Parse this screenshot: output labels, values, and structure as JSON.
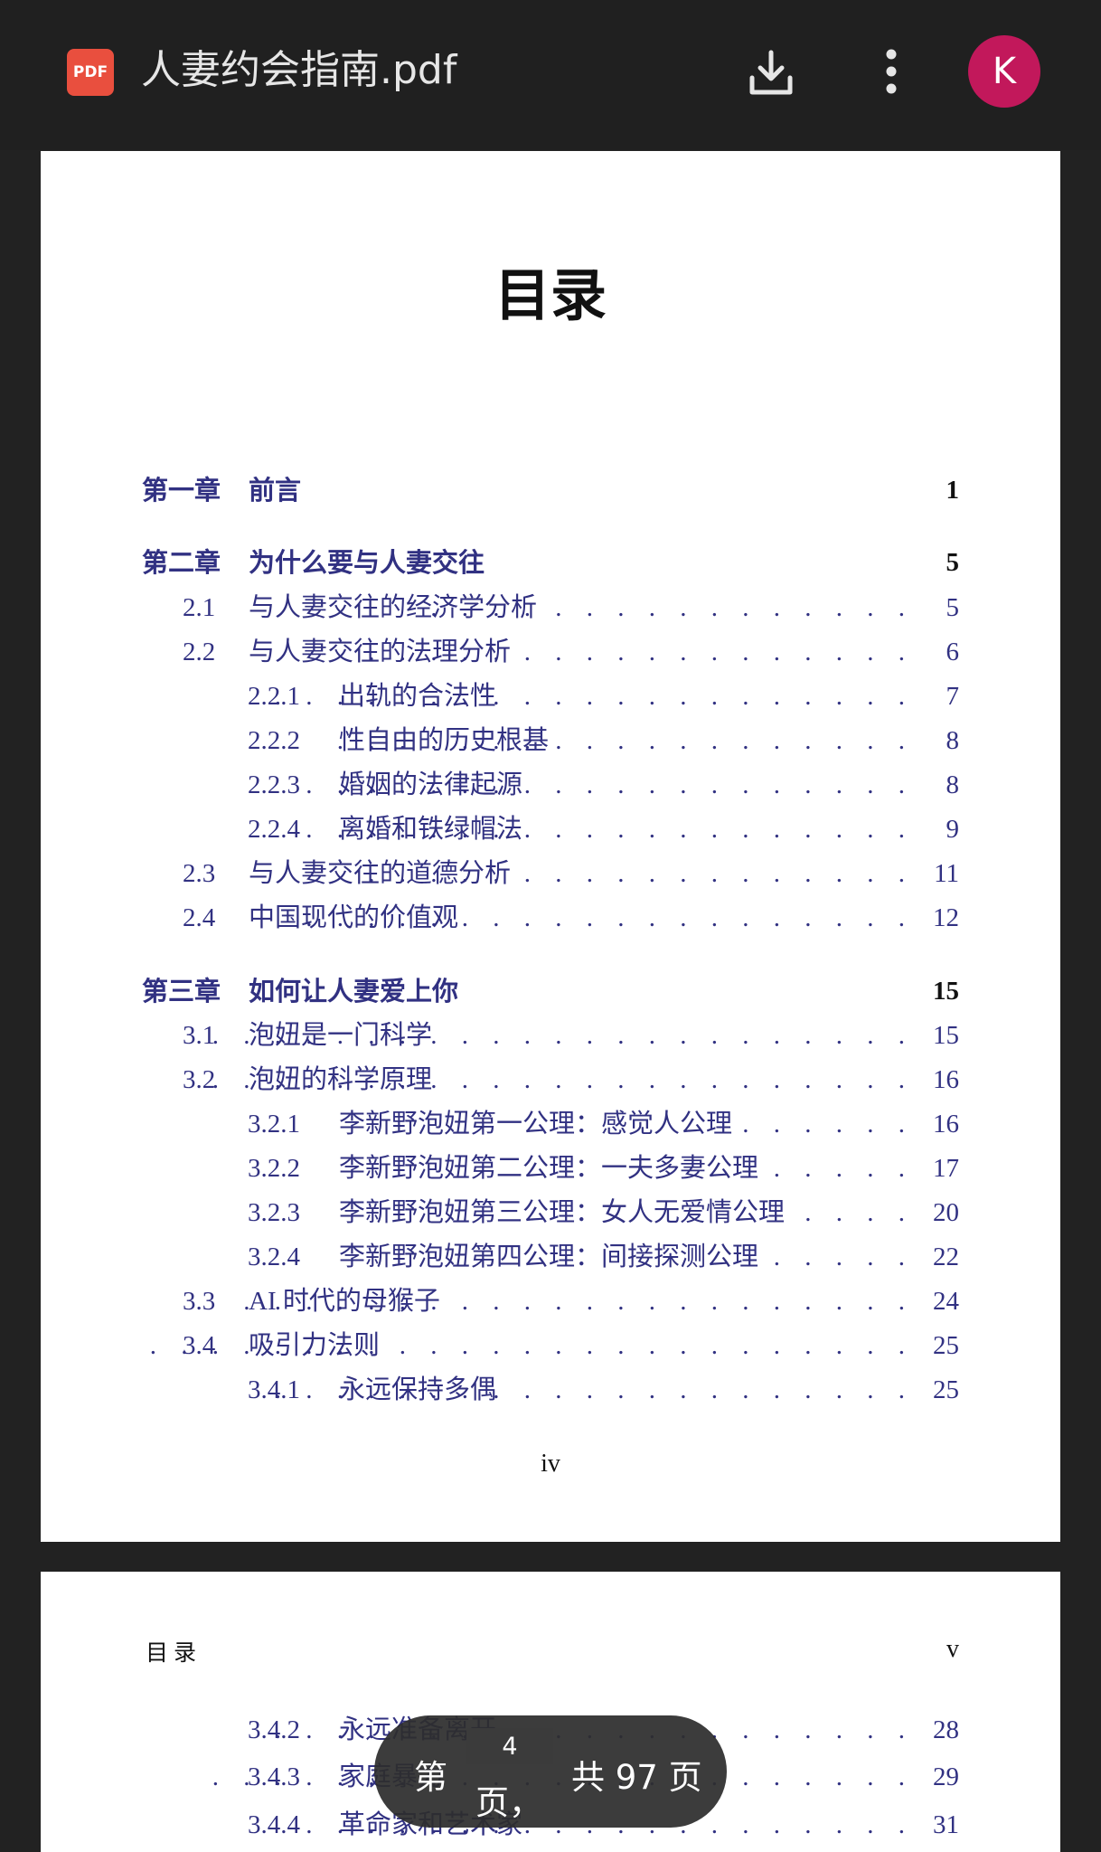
{
  "app_bar": {
    "pdf_badge": "PDF",
    "file_name": "人妻约会指南.pdf",
    "download_icon": "download-icon",
    "more_icon": "more-vert-icon",
    "avatar_letter": "K",
    "avatar_color": "#c2185b"
  },
  "colors": {
    "toc_link": "#313182",
    "background": "#222222",
    "pdf_badge": "#e94f3e"
  },
  "page1": {
    "title": "目录",
    "entries": [
      {
        "level": "chapter",
        "num": "第一章",
        "text": "前言",
        "page": "1",
        "dots": ""
      },
      {
        "level": "chapter",
        "num": "第二章",
        "text": "为什么要与人妻交往",
        "page": "5",
        "dots": ""
      },
      {
        "level": "section",
        "num": "2.1",
        "text": "与人妻交往的经济学分析",
        "page": "5",
        "dots": ". . . . . . . . . . . . . . . ."
      },
      {
        "level": "section",
        "num": "2.2",
        "text": "与人妻交往的法理分析",
        "page": "6",
        "dots": ". . . . . . . . . . . . . . . . . ."
      },
      {
        "level": "subsection",
        "num": "2.2.1",
        "text": "出轨的合法性",
        "page": "7",
        "dots": ". . . . . . . . . . . . . . . . . . . . ."
      },
      {
        "level": "subsection",
        "num": "2.2.2",
        "text": "性自由的历史根基",
        "page": "8",
        "dots": ". . . . . . . . . . . . . . . . . . ."
      },
      {
        "level": "subsection",
        "num": "2.2.3",
        "text": "婚姻的法律起源",
        "page": "8",
        "dots": ". . . . . . . . . . . . . . . . . . . ."
      },
      {
        "level": "subsection",
        "num": "2.2.4",
        "text": "离婚和铁绿帽法",
        "page": "9",
        "dots": ". . . . . . . . . . . . . . . . . . . ."
      },
      {
        "level": "section",
        "num": "2.3",
        "text": "与人妻交往的道德分析",
        "page": "11",
        "dots": ". . . . . . . . . . . . . . . . . ."
      },
      {
        "level": "section",
        "num": "2.4",
        "text": "中国现代的价值观",
        "page": "12",
        "dots": ". . . . . . . . . . . . . . . . . . . ."
      },
      {
        "level": "chapter",
        "num": "第三章",
        "text": "如何让人妻爱上你",
        "page": "15",
        "dots": ""
      },
      {
        "level": "section",
        "num": "3.1",
        "text": "泡妞是一门科学",
        "page": "15",
        "dots": ". . . . . . . . . . . . . . . . . . . . . . ."
      },
      {
        "level": "section",
        "num": "3.2",
        "text": "泡妞的科学原理",
        "page": "16",
        "dots": ". . . . . . . . . . . . . . . . . . . . . . ."
      },
      {
        "level": "subsection",
        "num": "3.2.1",
        "text": "李新野泡妞第一公理：感觉人公理",
        "page": "16",
        "dots": ". . . . . ."
      },
      {
        "level": "subsection",
        "num": "3.2.2",
        "text": "李新野泡妞第二公理：一夫多妻公理",
        "page": "17",
        "dots": ". . . . ."
      },
      {
        "level": "subsection",
        "num": "3.2.3",
        "text": "李新野泡妞第三公理：女人无爱情公理",
        "page": "20",
        "dots": ". . . ."
      },
      {
        "level": "subsection",
        "num": "3.2.4",
        "text": "李新野泡妞第四公理：间接探测公理",
        "page": "22",
        "dots": ". . . . ."
      },
      {
        "level": "section",
        "num": "3.3",
        "text": "AI 时代的母猴子",
        "page": "24",
        "dots": ". . . . . . . . . . . . . . . . . . . . . ."
      },
      {
        "level": "section",
        "num": "3.4",
        "text": "吸引力法则",
        "page": "25",
        "dots": ". . . . . . . . . . . . . . . . . . . . . . . . ."
      },
      {
        "level": "subsection",
        "num": "3.4.1",
        "text": "永远保持多偶",
        "page": "25",
        "dots": ". . . . . . . . . . . . . . . . . . . . ."
      }
    ],
    "footer": "iv"
  },
  "page2": {
    "running_head": "目录",
    "page_numeral": "v",
    "entries": [
      {
        "level": "subsection",
        "num": "3.4.2",
        "text": "永远准备离开",
        "page": "28",
        "dots": ". . . . . . . . . . . . . . . . . . . . ."
      },
      {
        "level": "subsection",
        "num": "3.4.3",
        "text": "家庭暴力",
        "page": "29",
        "dots": ". . . . . . . . . . . . . . . . . . . . . . ."
      },
      {
        "level": "subsection",
        "num": "3.4.4",
        "text": "革命家和艺术家",
        "page": "31",
        "dots": ". . . . . . . . . . . . . . . . . . . ."
      }
    ]
  },
  "page_indicator": {
    "prefix": "第",
    "current_page": "4",
    "middle": "页，",
    "total": "共 97 页"
  }
}
